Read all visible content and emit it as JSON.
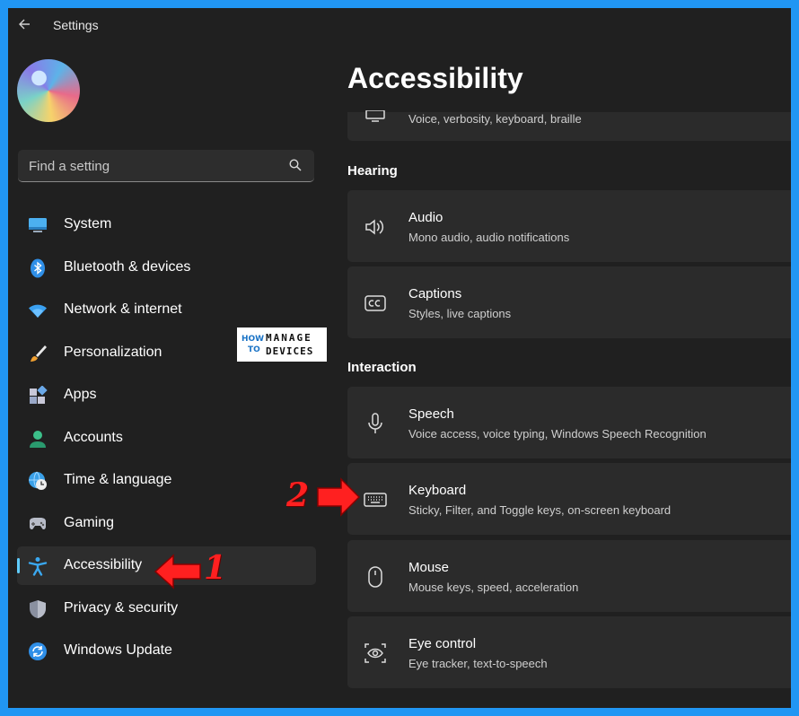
{
  "window": {
    "title": "Settings"
  },
  "search": {
    "placeholder": "Find a setting"
  },
  "sidebar": {
    "items": [
      {
        "label": "System",
        "icon": "system-icon"
      },
      {
        "label": "Bluetooth & devices",
        "icon": "bluetooth-icon"
      },
      {
        "label": "Network & internet",
        "icon": "wifi-icon"
      },
      {
        "label": "Personalization",
        "icon": "brush-icon"
      },
      {
        "label": "Apps",
        "icon": "apps-icon"
      },
      {
        "label": "Accounts",
        "icon": "account-icon"
      },
      {
        "label": "Time & language",
        "icon": "clock-globe-icon"
      },
      {
        "label": "Gaming",
        "icon": "gamepad-icon"
      },
      {
        "label": "Accessibility",
        "icon": "accessibility-icon",
        "selected": true
      },
      {
        "label": "Privacy & security",
        "icon": "shield-icon"
      },
      {
        "label": "Windows Update",
        "icon": "update-icon"
      }
    ]
  },
  "watermark": {
    "how": "HOW",
    "to": "TO",
    "line1": "MANAGE",
    "line2": "DEVICES"
  },
  "main": {
    "title": "Accessibility",
    "top_card": {
      "subtitle": "Voice, verbosity, keyboard, braille",
      "icon": "narrator-icon"
    },
    "sections": [
      {
        "heading": "Hearing",
        "cards": [
          {
            "title": "Audio",
            "subtitle": "Mono audio, audio notifications",
            "icon": "speaker-icon"
          },
          {
            "title": "Captions",
            "subtitle": "Styles, live captions",
            "icon": "captions-icon"
          }
        ]
      },
      {
        "heading": "Interaction",
        "cards": [
          {
            "title": "Speech",
            "subtitle": "Voice access, voice typing, Windows Speech Recognition",
            "icon": "microphone-icon"
          },
          {
            "title": "Keyboard",
            "subtitle": "Sticky, Filter, and Toggle keys, on-screen keyboard",
            "icon": "keyboard-icon"
          },
          {
            "title": "Mouse",
            "subtitle": "Mouse keys, speed, acceleration",
            "icon": "mouse-icon"
          },
          {
            "title": "Eye control",
            "subtitle": "Eye tracker, text-to-speech",
            "icon": "eye-control-icon"
          }
        ]
      }
    ]
  },
  "annotations": {
    "step1": "1",
    "step2": "2",
    "color": "#ff2020"
  },
  "colors": {
    "accent": "#60cdff",
    "frame_border": "#2196f3",
    "background": "#202020",
    "card": "#2b2b2b"
  }
}
